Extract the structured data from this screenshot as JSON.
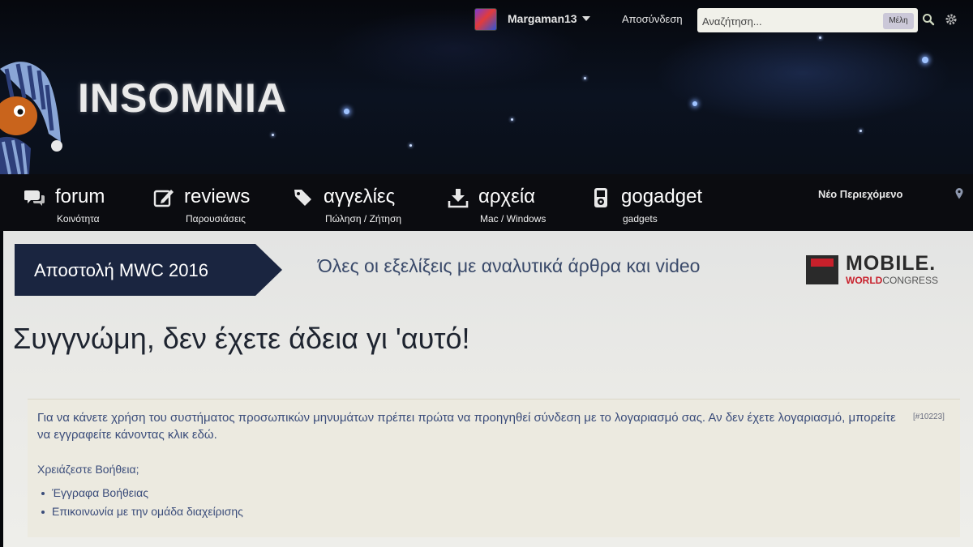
{
  "user_bar": {
    "username": "Margaman13",
    "logout_label": "Αποσύνδεση",
    "search_placeholder": "Αναζήτηση...",
    "search_scope": "Μέλη"
  },
  "logo": {
    "text": "INSOMNIA"
  },
  "nav": {
    "items": [
      {
        "title": "forum",
        "subtitle": "Κοινότητα",
        "icon": "chat-bubbles-icon"
      },
      {
        "title": "reviews",
        "subtitle": "Παρουσιάσεις",
        "icon": "edit-icon"
      },
      {
        "title": "αγγελίες",
        "subtitle": "Πώληση / Ζήτηση",
        "icon": "tags-icon"
      },
      {
        "title": "αρχεία",
        "subtitle": "Mac / Windows",
        "icon": "download-icon"
      },
      {
        "title": "gogadget",
        "subtitle": "gadgets",
        "icon": "ipod-icon"
      }
    ],
    "new_content_label": "Νέο Περιεχόμενο"
  },
  "banner": {
    "label": "Αποστολή MWC 2016",
    "tagline": "Όλες οι εξελίξεις με αναλυτικά άρθρα και video",
    "mwc_mobile": "MOBILE.",
    "mwc_world": "WORLD",
    "mwc_congress": "CONGRESS"
  },
  "error": {
    "title": "Συγγνώμη, δεν έχετε άδεια γι 'αυτό!",
    "message": "Για να κάνετε χρήση του συστήματος προσωπικών μηνυμάτων πρέπει πρώτα να προηγηθεί σύνδεση με το λογαριασμό σας. Αν δεν έχετε λογαριασμό, μπορείτε να εγγραφείτε κάνοντας κλικ εδώ.",
    "code": "[#10223]",
    "help_label": "Χρειάζεστε Βοήθεια;",
    "help_links": [
      "Έγγραφα Βοήθειας",
      "Επικοινωνία με την ομάδα διαχείρισης"
    ]
  },
  "colors": {
    "header_bg": "#05070b",
    "nav_bg": "#0b0c10",
    "banner_bg": "#1a2540",
    "link_text": "#3a4c7a",
    "mwc_red": "#c8202b"
  }
}
